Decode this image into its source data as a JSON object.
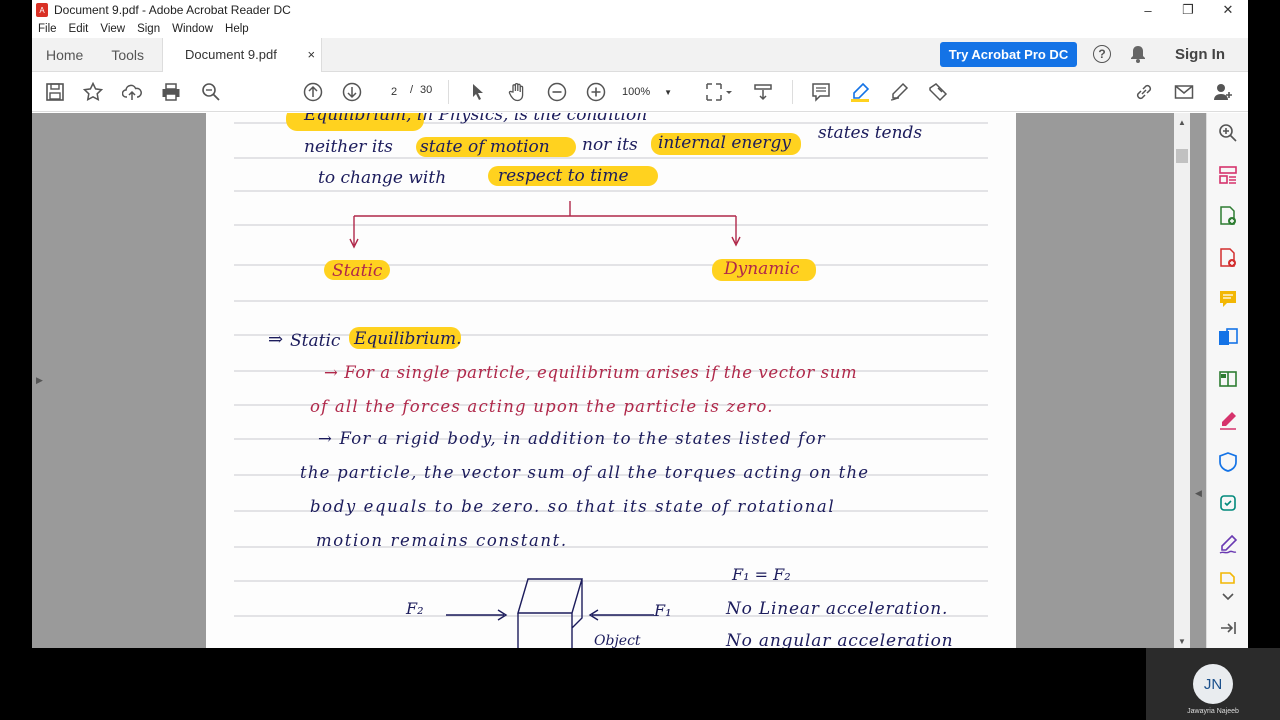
{
  "window": {
    "title": "Document 9.pdf - Adobe Acrobat Reader DC",
    "controls": [
      "–",
      "❐",
      "✕"
    ]
  },
  "menu": [
    "File",
    "Edit",
    "View",
    "Sign",
    "Window",
    "Help"
  ],
  "tabs": {
    "home": "Home",
    "tools": "Tools",
    "document": "Document 9.pdf",
    "close": "×"
  },
  "header": {
    "try_button": "Try Acrobat Pro DC",
    "help": "?",
    "signin": "Sign In"
  },
  "toolbar": {
    "page_current": "2",
    "page_separator": "/",
    "page_total": "30",
    "zoom": "100%"
  },
  "handwriting": {
    "line1": "Equilibrium, in Physics, is the condition",
    "line2a": "neither its",
    "line2b": "state of motion",
    "line2c": "nor its",
    "line2d": "internal energy",
    "line2e": "states tends",
    "line3a": "to change with",
    "line3b": "respect to time",
    "static": "Static",
    "dynamic": "Dynamic",
    "heading_arrow": "⇒",
    "heading_static": "Static",
    "heading_eq": "Equilibrium.",
    "red1": "→   For a single particle, equilibrium arises if the vector sum",
    "red2": "of all the forces acting upon the particle is zero.",
    "blue1": "→   For a rigid body, in addition to the states listed for",
    "blue2": "the particle, the vector sum of all the torques acting on the",
    "blue3": "body equals to be zero. so that its state of rotational",
    "blue4": "motion remains constant.",
    "f1eqf2": "F₁ = F₂",
    "no_linear": "No Linear acceleration.",
    "no_angular": "No angular acceleration",
    "f2": "F₂",
    "f1": "F₁",
    "object": "Object"
  },
  "webcam": {
    "initials": "JN",
    "name": "Jawayria Najeeb"
  },
  "colors": {
    "accent": "#1473e6",
    "highlight": "#ffd21f",
    "ink_red": "#b0284a",
    "ink_blue": "#1c1c5c"
  }
}
